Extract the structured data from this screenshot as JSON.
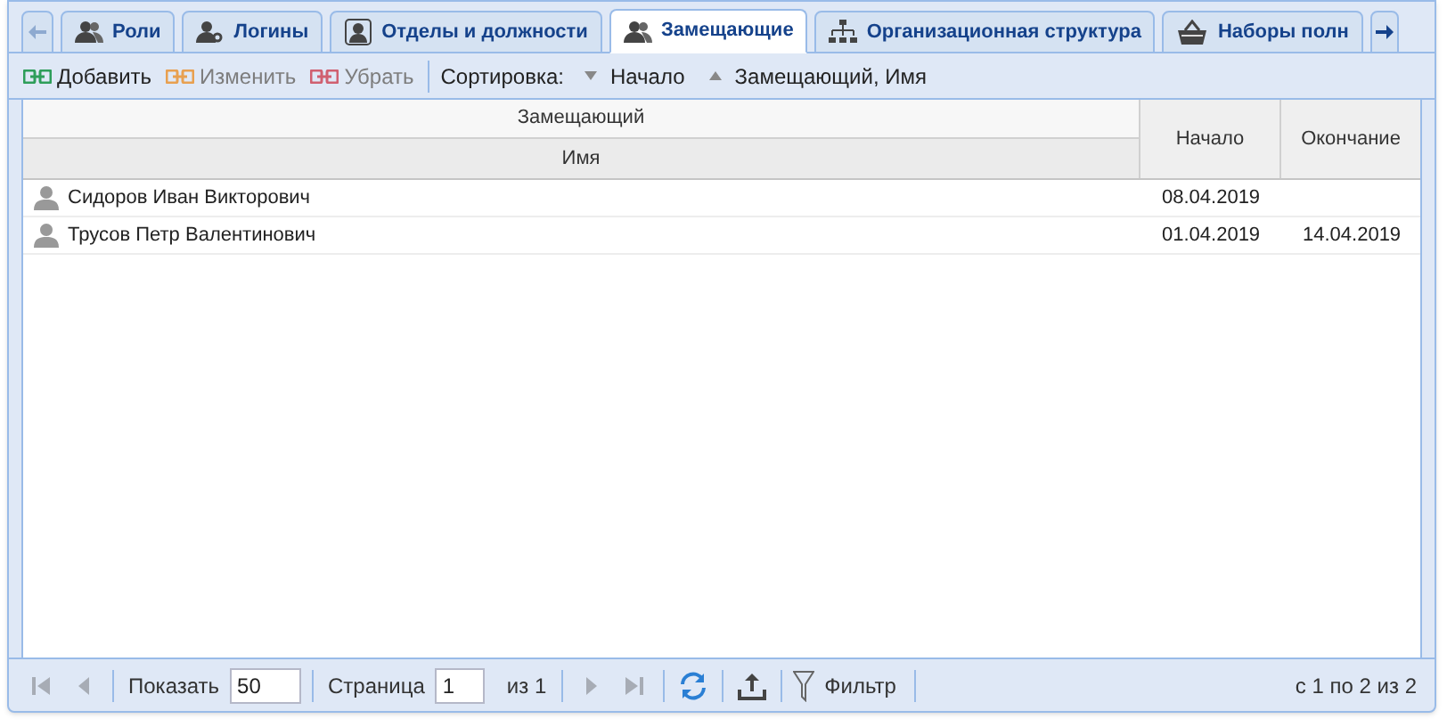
{
  "tabs": [
    {
      "label": "Роли",
      "selected": false
    },
    {
      "label": "Логины",
      "selected": false
    },
    {
      "label": "Отделы и должности",
      "selected": false
    },
    {
      "label": "Замещающие",
      "selected": true
    },
    {
      "label": "Организационная структура",
      "selected": false
    },
    {
      "label": "Наборы полн",
      "selected": false
    }
  ],
  "toolbar": {
    "buttons": [
      {
        "label": "Добавить",
        "disabled": false
      },
      {
        "label": "Изменить",
        "disabled": true
      },
      {
        "label": "Убрать",
        "disabled": true
      }
    ],
    "sort_label": "Сортировка:",
    "sorters": [
      {
        "label": "Начало"
      },
      {
        "label": "Замещающий, Имя"
      }
    ]
  },
  "table": {
    "group_header": "Замещающий",
    "columns": [
      "Имя",
      "Начало",
      "Окончание"
    ],
    "rows": [
      {
        "name": "Сидоров Иван Викторович",
        "start": "08.04.2019",
        "end": ""
      },
      {
        "name": "Трусов Петр Валентинович",
        "start": "01.04.2019",
        "end": "14.04.2019"
      }
    ]
  },
  "paging": {
    "first_disabled": true,
    "prev_disabled": true,
    "next_disabled": true,
    "last_disabled": true,
    "show_label": "Показать",
    "page_size": "50",
    "page_label": "Страница",
    "page": "1",
    "of_pages": "из 1",
    "filter_label": "Фильтр",
    "summary": "с 1 по 2 из 2"
  }
}
